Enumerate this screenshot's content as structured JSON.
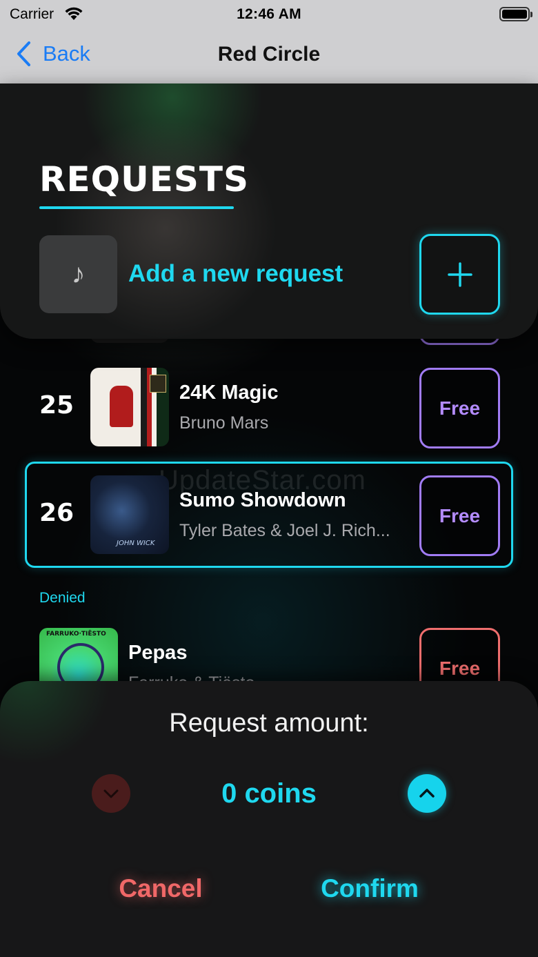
{
  "status_bar": {
    "carrier": "Carrier",
    "time": "12:46 AM",
    "icons": [
      "wifi-icon",
      "battery-icon"
    ]
  },
  "nav": {
    "back_label": "Back",
    "title": "Red Circle"
  },
  "requests": {
    "title": "REQUESTS",
    "add_label": "Add a new request",
    "add_icon": "music-note-icon",
    "add_button_icon": "plus-icon"
  },
  "list": {
    "items": [
      {
        "rank": "25",
        "song": "24K Magic",
        "artist": "Bruno Mars",
        "price": "Free",
        "art": "24K Magic album art"
      },
      {
        "rank": "26",
        "song": "Sumo Showdown",
        "artist": "Tyler Bates & Joel J. Rich...",
        "price": "Free",
        "art": "John Wick album art",
        "art_text": "JOHN WICK"
      }
    ],
    "watermark": "UpdateStar.com",
    "denied_label": "Denied",
    "denied_items": [
      {
        "song": "Pepas",
        "artist": "Farruko & Tiësto",
        "price": "Free",
        "art_text": "FARRUKO·TIËSTO"
      }
    ]
  },
  "sheet": {
    "title": "Request amount:",
    "amount": "0 coins",
    "decrease_icon": "chevron-down-icon",
    "increase_icon": "chevron-up-icon",
    "cancel_label": "Cancel",
    "confirm_label": "Confirm"
  },
  "colors": {
    "accent": "#1fd8ef",
    "price_border": "#a17cf4",
    "denied": "#ef6e6e",
    "back_link": "#1a7cf5"
  }
}
